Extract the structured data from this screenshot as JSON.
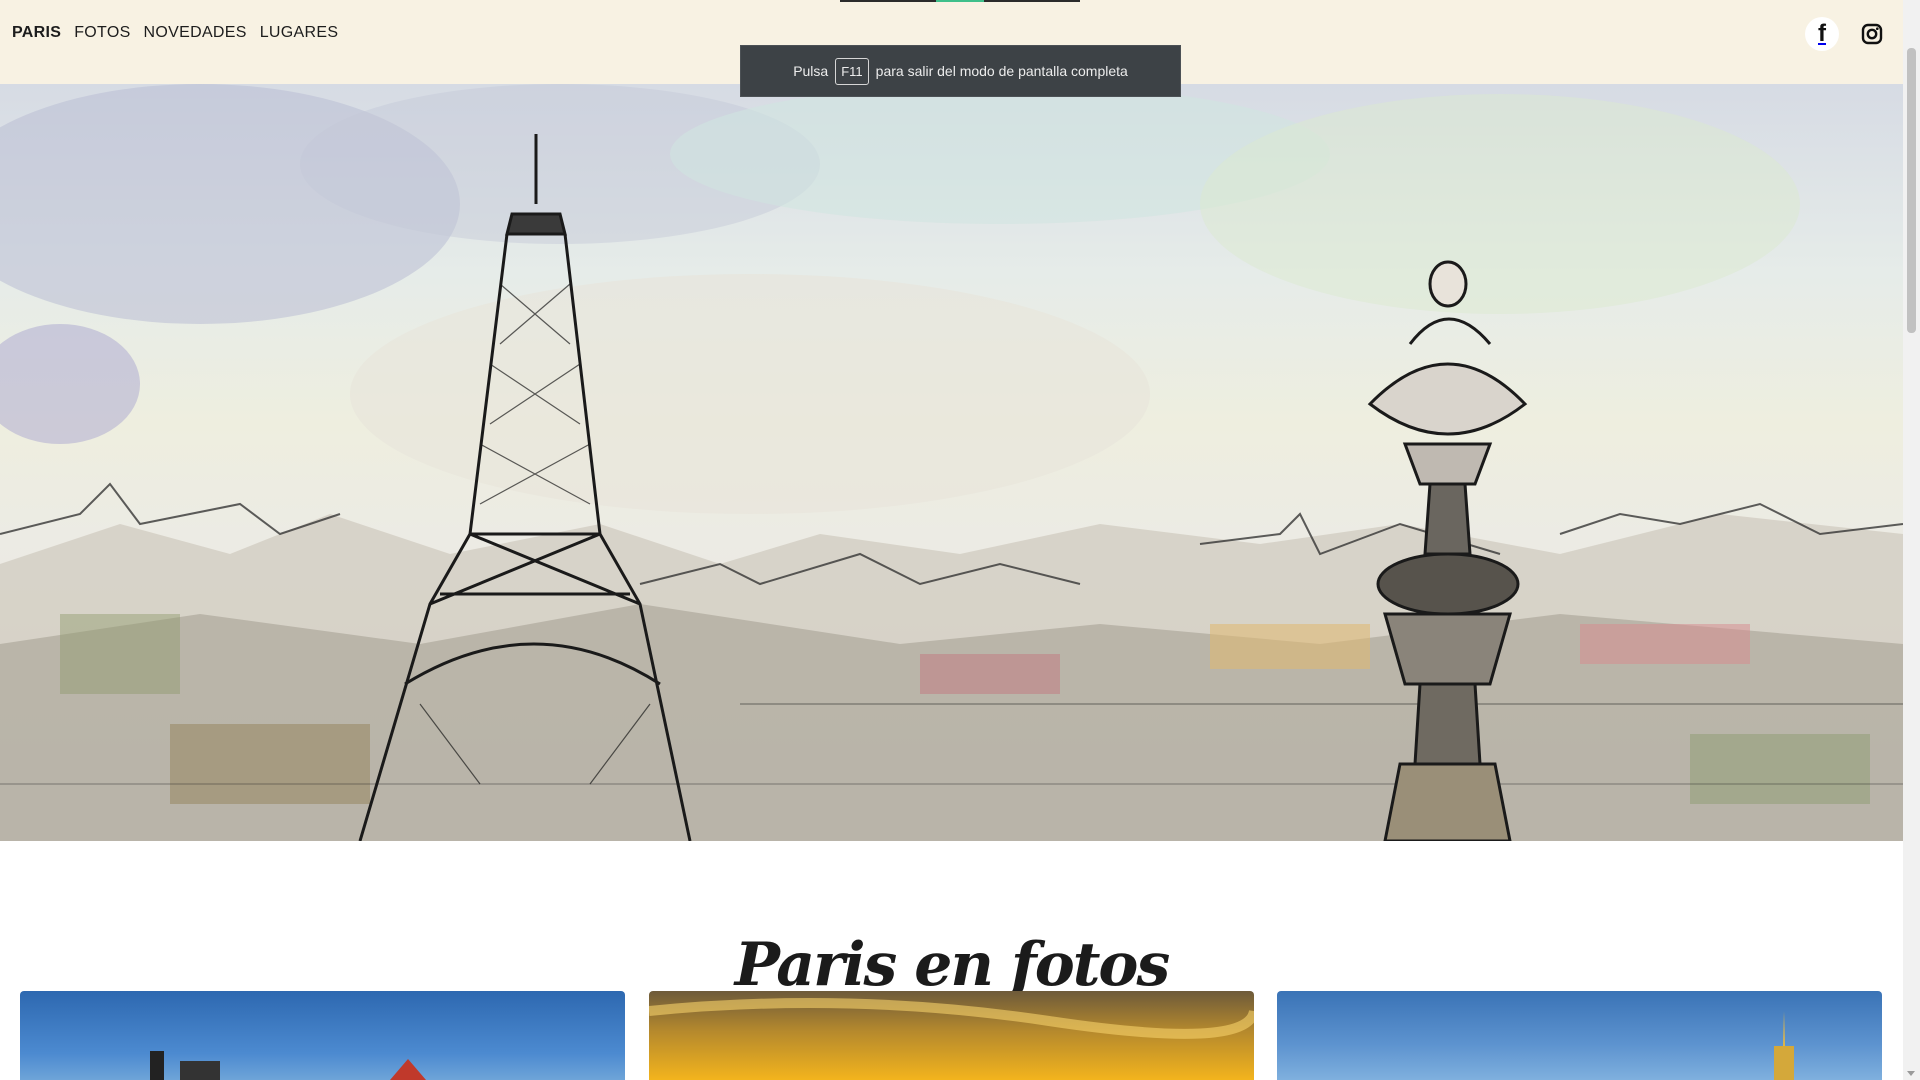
{
  "nav": {
    "items": [
      {
        "label": "PARIS",
        "active": true
      },
      {
        "label": "FOTOS",
        "active": false
      },
      {
        "label": "NOVEDADES",
        "active": false
      },
      {
        "label": "LUGARES",
        "active": false
      }
    ]
  },
  "social": {
    "facebook_glyph": "f",
    "icons": [
      "facebook-icon",
      "instagram-icon"
    ]
  },
  "toast": {
    "prefix": "Pulsa",
    "key": "F11",
    "suffix": "para salir del modo de pantalla completa"
  },
  "section": {
    "title": "Paris en fotos"
  },
  "colors": {
    "topbar": "#f8f2e3",
    "toast_bg": "#3d4246",
    "accent": "#3fbf8a"
  }
}
